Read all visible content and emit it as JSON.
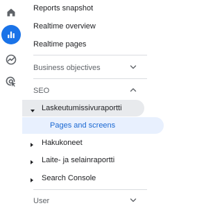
{
  "rail": {
    "icons": [
      {
        "name": "home-icon"
      },
      {
        "name": "reports-icon"
      },
      {
        "name": "explore-icon"
      },
      {
        "name": "advertising-icon"
      }
    ]
  },
  "nav": {
    "top_items": [
      {
        "label": "Reports snapshot"
      },
      {
        "label": "Realtime overview"
      },
      {
        "label": "Realtime pages"
      }
    ],
    "section_business": {
      "label": "Business objectives"
    },
    "section_seo": {
      "label": "SEO",
      "groups": [
        {
          "label": "Laskeutumissivuraportti",
          "expanded": true,
          "children": [
            {
              "label": "Pages and screens"
            }
          ]
        },
        {
          "label": "Hakukoneet"
        },
        {
          "label": "Laite- ja selainraportti"
        },
        {
          "label": "Search Console"
        }
      ]
    },
    "section_user": {
      "label": "User"
    }
  },
  "colors": {
    "accent": "#1a73e8",
    "selected_bg": "#e8f0fe",
    "selected_text": "#1967d2",
    "expanded_bg": "#e8eaed"
  }
}
